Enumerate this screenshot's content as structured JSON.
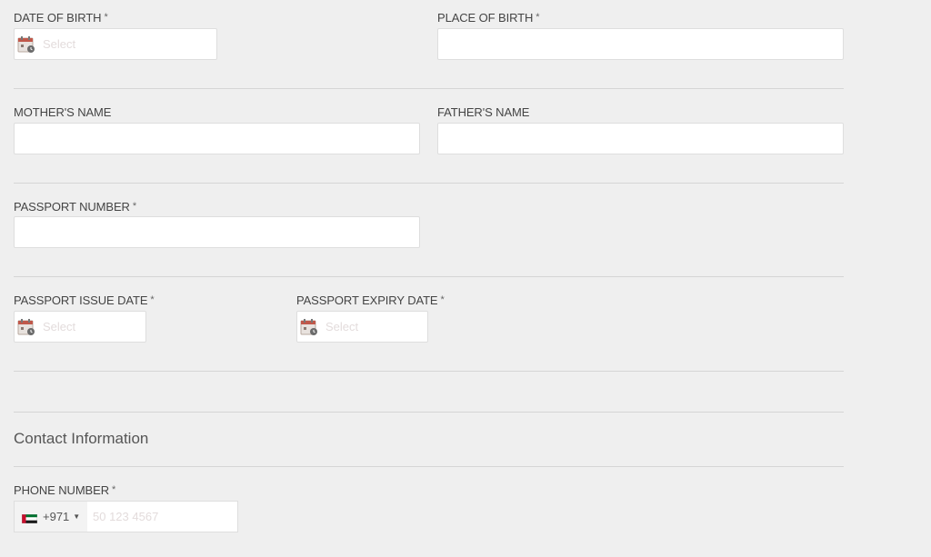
{
  "required_mark": "*",
  "fields": {
    "date_of_birth": {
      "label": "DATE OF BIRTH",
      "placeholder": "Select"
    },
    "place_of_birth": {
      "label": "PLACE OF BIRTH",
      "value": ""
    },
    "mothers_name": {
      "label": "MOTHER'S NAME",
      "value": ""
    },
    "fathers_name": {
      "label": "FATHER'S NAME",
      "value": ""
    },
    "passport_number": {
      "label": "PASSPORT NUMBER",
      "value": ""
    },
    "passport_issue_date": {
      "label": "PASSPORT ISSUE DATE",
      "placeholder": "Select"
    },
    "passport_expiry_date": {
      "label": "PASSPORT EXPIRY DATE",
      "placeholder": "Select"
    }
  },
  "contact": {
    "section_title": "Contact Information",
    "phone": {
      "label": "PHONE NUMBER",
      "country_code": "+971",
      "country_flag": "uae-flag-icon",
      "placeholder": "50 123 4567"
    }
  },
  "colors": {
    "background": "#efefef",
    "input_background": "#ffffff",
    "border": "#dedede",
    "placeholder": "#e3dcdc",
    "divider": "#d5d5d5",
    "calendar_accent": "#c0584a"
  }
}
